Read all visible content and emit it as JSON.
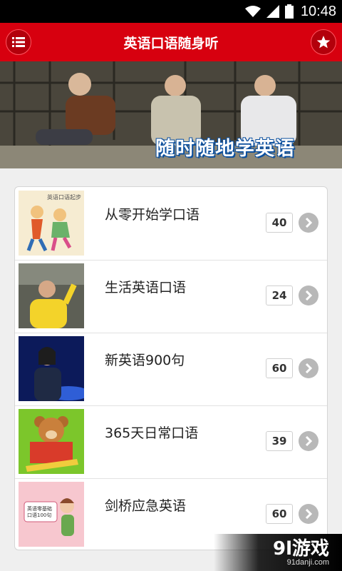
{
  "status_bar": {
    "time": "10:48",
    "icons": [
      "wifi-icon",
      "signal-icon",
      "battery-icon"
    ]
  },
  "app_bar": {
    "title": "英语口语随身听",
    "left_icon": "menu-list-icon",
    "right_icon": "star-icon",
    "color": "#d7000f"
  },
  "banner": {
    "slogan": "随时随地学英语"
  },
  "courses": [
    {
      "title": "从零开始学口语",
      "count": "40",
      "thumb_caption": "英语口语起步"
    },
    {
      "title": "生活英语口语",
      "count": "24"
    },
    {
      "title": "新英语900句",
      "count": "60"
    },
    {
      "title": "365天日常口语",
      "count": "39"
    },
    {
      "title": "剑桥应急英语",
      "count": "60",
      "thumb_caption": "英语零基础口语100句"
    }
  ],
  "watermark": {
    "logo": "9l游戏",
    "url": "91danji.com"
  }
}
